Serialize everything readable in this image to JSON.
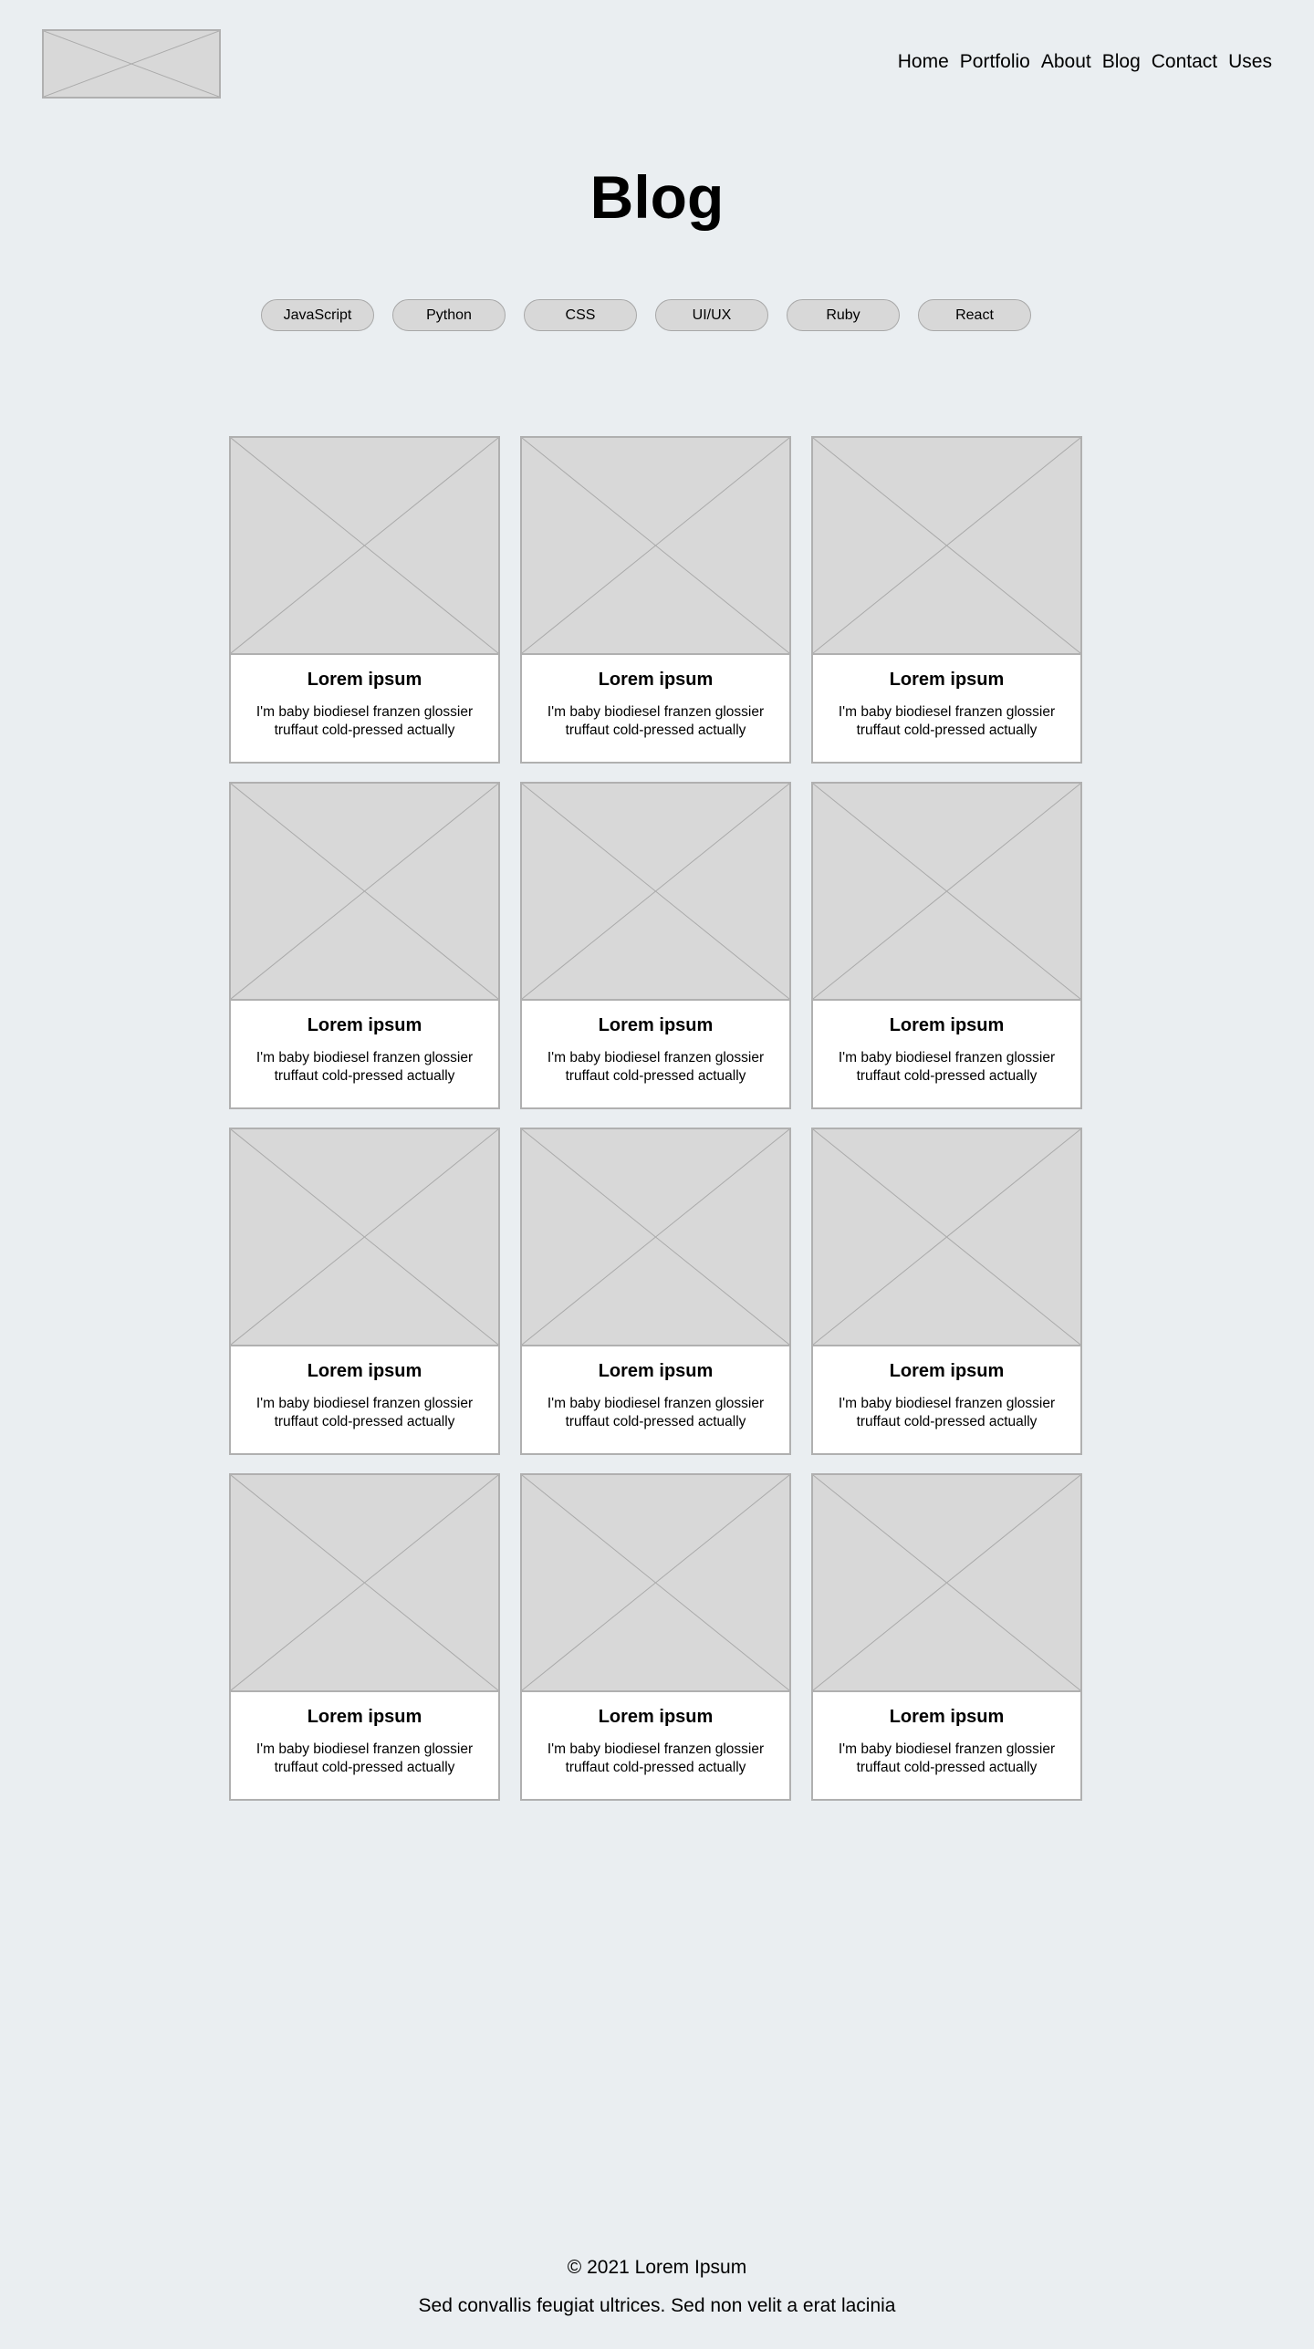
{
  "header": {
    "logo_alt": "logo",
    "nav": [
      "Home",
      "Portfolio",
      "About",
      "Blog",
      "Contact",
      "Uses"
    ]
  },
  "page_title": "Blog",
  "tags": [
    "JavaScript",
    "Python",
    "CSS",
    "UI/UX",
    "Ruby",
    "React"
  ],
  "posts": [
    {
      "title": "Lorem ipsum",
      "excerpt": "I'm baby biodiesel franzen glossier truffaut cold-pressed actually"
    },
    {
      "title": "Lorem ipsum",
      "excerpt": "I'm baby biodiesel franzen glossier truffaut cold-pressed actually"
    },
    {
      "title": "Lorem ipsum",
      "excerpt": "I'm baby biodiesel franzen glossier truffaut cold-pressed actually"
    },
    {
      "title": "Lorem ipsum",
      "excerpt": "I'm baby biodiesel franzen glossier truffaut cold-pressed actually"
    },
    {
      "title": "Lorem ipsum",
      "excerpt": "I'm baby biodiesel franzen glossier truffaut cold-pressed actually"
    },
    {
      "title": "Lorem ipsum",
      "excerpt": "I'm baby biodiesel franzen glossier truffaut cold-pressed actually"
    },
    {
      "title": "Lorem ipsum",
      "excerpt": "I'm baby biodiesel franzen glossier truffaut cold-pressed actually"
    },
    {
      "title": "Lorem ipsum",
      "excerpt": "I'm baby biodiesel franzen glossier truffaut cold-pressed actually"
    },
    {
      "title": "Lorem ipsum",
      "excerpt": "I'm baby biodiesel franzen glossier truffaut cold-pressed actually"
    },
    {
      "title": "Lorem ipsum",
      "excerpt": "I'm baby biodiesel franzen glossier truffaut cold-pressed actually"
    },
    {
      "title": "Lorem ipsum",
      "excerpt": "I'm baby biodiesel franzen glossier truffaut cold-pressed actually"
    },
    {
      "title": "Lorem ipsum",
      "excerpt": "I'm baby biodiesel franzen glossier truffaut cold-pressed actually"
    }
  ],
  "footer": {
    "copyright": "© 2021 Lorem Ipsum",
    "tagline": "Sed convallis feugiat ultrices. Sed non velit a erat lacinia"
  }
}
